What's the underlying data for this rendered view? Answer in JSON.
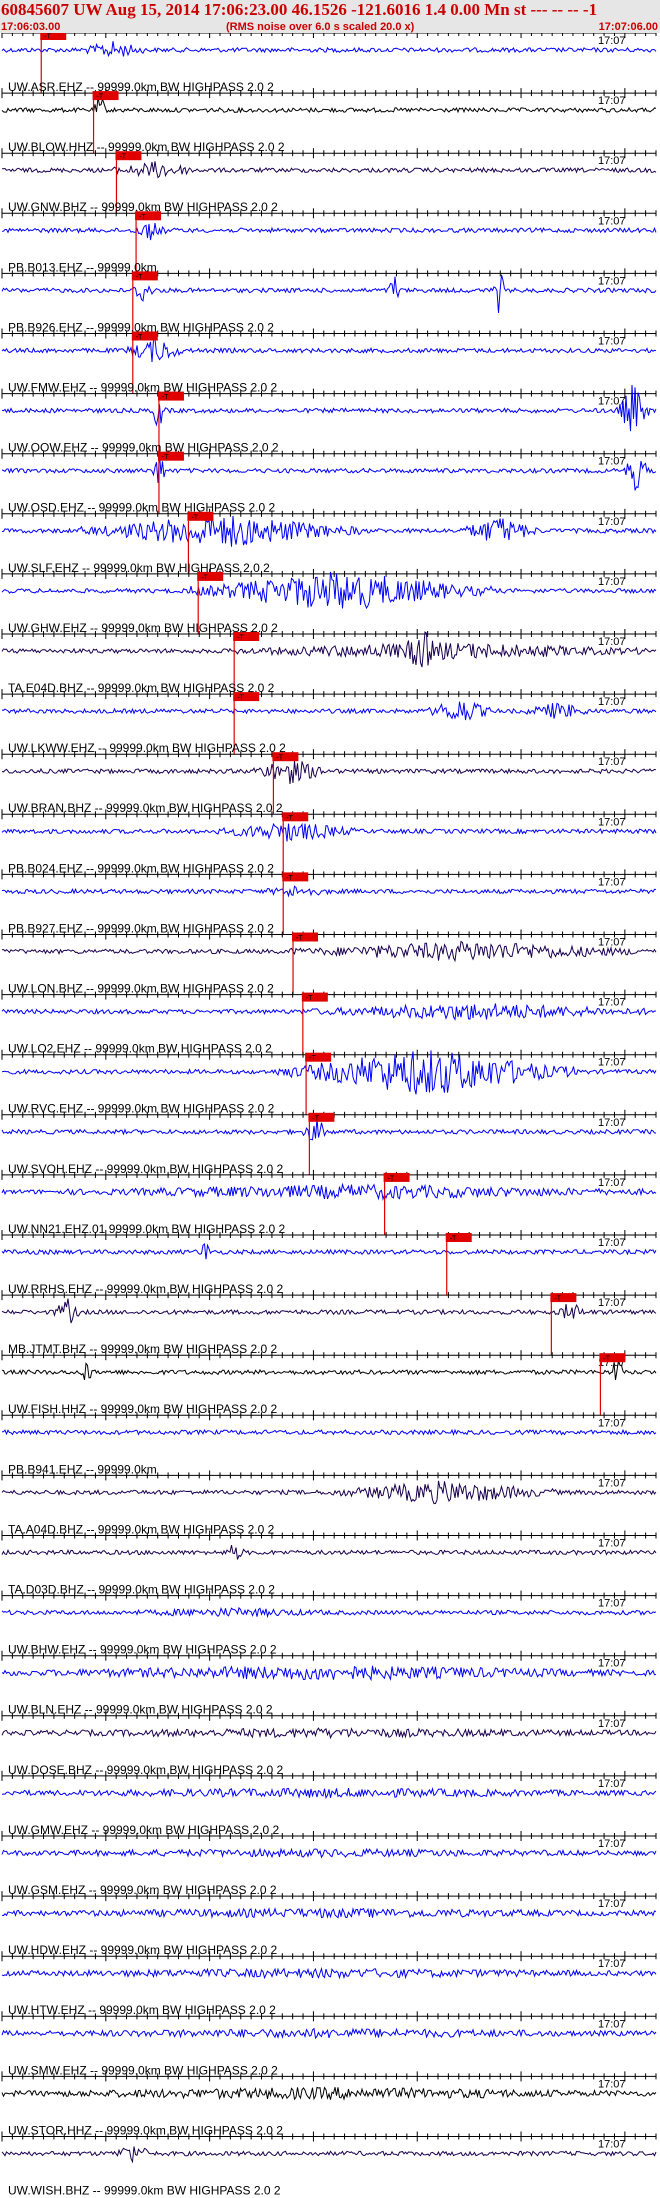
{
  "header": {
    "title": "60845607 UW Aug 15, 2014 17:06:23.00   46.1526 -121.6016  1.4 0.00 Mn st --- -- --   -1",
    "start_time": "17:06:03.00",
    "scale_note": "(RMS noise over 6.0 s scaled 20.0 x)",
    "end_time": "17:07:06.00"
  },
  "tick_time_label": "17:07",
  "pick_marker_text": "-T",
  "traces": [
    {
      "label": "UW.ASR.EHZ -- 99999.0km BW  HIGHPASS  2.0  2",
      "color": "#0000ff",
      "pick": 0.06
    },
    {
      "label": "UW.BLOW.HHZ -- 99999.0km BW  HIGHPASS  2.0  2",
      "color": "#000000",
      "pick": 0.14
    },
    {
      "label": "UW.GNW.BHZ -- 99999.0km BW  HIGHPASS  2.0  2",
      "color": "#1a0050",
      "pick": 0.175
    },
    {
      "label": "PB.B013.EHZ -- 99999.0km",
      "color": "#0000ff",
      "pick": 0.205
    },
    {
      "label": "PB.B926.EHZ -- 99999.0km BW  HIGHPASS  2.0  2",
      "color": "#0000ff",
      "pick": 0.2
    },
    {
      "label": "UW.FMW.EHZ -- 99999.0km BW  HIGHPASS  2.0  2",
      "color": "#0000ff",
      "pick": 0.2
    },
    {
      "label": "UW.OOW.EHZ -- 99999.0km BW  HIGHPASS  2.0  2",
      "color": "#0000ff",
      "pick": 0.24
    },
    {
      "label": "UW.OSD.EHZ -- 99999.0km BW  HIGHPASS  2.0  2",
      "color": "#0000ff",
      "pick": 0.24
    },
    {
      "label": "UW.SLF.EHZ -- 99999.0km BW  HIGHPASS  2.0  2",
      "color": "#0000ff",
      "pick": 0.285
    },
    {
      "label": "UW.GHW.EHZ -- 99999.0km BW  HIGHPASS  2.0  2",
      "color": "#0000ff",
      "pick": 0.3
    },
    {
      "label": "TA.E04D.BHZ -- 99999.0km BW  HIGHPASS  2.0  2",
      "color": "#1a0050",
      "pick": 0.355
    },
    {
      "label": "UW.LKWW.EHZ -- 99999.0km BW  HIGHPASS  2.0  2",
      "color": "#0000ff",
      "pick": 0.355
    },
    {
      "label": "UW.BRAN.BHZ -- 99999.0km BW  HIGHPASS  2.0  2",
      "color": "#1a0050",
      "pick": 0.415
    },
    {
      "label": "PB.B024.EHZ -- 99999.0km BW  HIGHPASS  2.0  2",
      "color": "#0000ff",
      "pick": 0.43
    },
    {
      "label": "PB.B927.EHZ -- 99999.0km BW  HIGHPASS  2.0  2",
      "color": "#0000ff",
      "pick": 0.43
    },
    {
      "label": "UW.LON.BHZ -- 99999.0km BW  HIGHPASS  2.0  2",
      "color": "#1a0050",
      "pick": 0.445
    },
    {
      "label": "UW.LO2.EHZ -- 99999.0km BW  HIGHPASS  2.0  2",
      "color": "#0000ff",
      "pick": 0.46
    },
    {
      "label": "UW.RVC.EHZ -- 99999.0km BW  HIGHPASS  2.0  2",
      "color": "#0000ff",
      "pick": 0.465
    },
    {
      "label": "UW.SVOH.EHZ -- 99999.0km BW  HIGHPASS  2.0  2",
      "color": "#0000ff",
      "pick": 0.47
    },
    {
      "label": "UW.NN21.EHZ.01 99999.0km BW  HIGHPASS  2.0  2",
      "color": "#0000ff",
      "pick": 0.585
    },
    {
      "label": "UW.RRHS.EHZ -- 99999.0km BW  HIGHPASS  2.0  2",
      "color": "#0000ff",
      "pick": 0.68
    },
    {
      "label": "MB.JTMT.BHZ -- 99999.0km BW  HIGHPASS  2.0  2",
      "color": "#1a0050",
      "pick": 0.84
    },
    {
      "label": "UW.FISH.HHZ -- 99999.0km BW  HIGHPASS  2.0  2",
      "color": "#000000",
      "pick": 0.915
    },
    {
      "label": "PB.B941.EHZ -- 99999.0km",
      "color": "#0000ff",
      "pick": null
    },
    {
      "label": "TA.A04D.BHZ -- 99999.0km BW  HIGHPASS  2.0  2",
      "color": "#1a0050",
      "pick": null
    },
    {
      "label": "TA.D03D.BHZ -- 99999.0km BW  HIGHPASS  2.0  2",
      "color": "#1a0050",
      "pick": null
    },
    {
      "label": "UW.BHW.EHZ -- 99999.0km BW  HIGHPASS  2.0  2",
      "color": "#0000ff",
      "pick": null
    },
    {
      "label": "UW.BLN.EHZ -- 99999.0km BW  HIGHPASS  2.0  2",
      "color": "#0000ff",
      "pick": null
    },
    {
      "label": "UW.DOSE.BHZ -- 99999.0km BW  HIGHPASS  2.0  2",
      "color": "#1a0050",
      "pick": null
    },
    {
      "label": "UW.GMW.EHZ -- 99999.0km BW  HIGHPASS  2.0  2",
      "color": "#0000ff",
      "pick": null
    },
    {
      "label": "UW.GSM.EHZ -- 99999.0km BW  HIGHPASS  2.0  2",
      "color": "#0000ff",
      "pick": null
    },
    {
      "label": "UW.HDW.EHZ -- 99999.0km BW  HIGHPASS  2.0  2",
      "color": "#0000ff",
      "pick": null
    },
    {
      "label": "UW.HTW.EHZ -- 99999.0km BW  HIGHPASS  2.0  2",
      "color": "#0000ff",
      "pick": null
    },
    {
      "label": "UW.SMW.EHZ -- 99999.0km BW  HIGHPASS  2.0  2",
      "color": "#0000ff",
      "pick": null
    },
    {
      "label": "UW.STOR.HHZ -- 99999.0km BW  HIGHPASS  2.0  2",
      "color": "#000000",
      "pick": null
    },
    {
      "label": "UW.WISH.BHZ -- 99999.0km BW  HIGHPASS  2.0  2",
      "color": "#1a0050",
      "pick": null
    }
  ]
}
